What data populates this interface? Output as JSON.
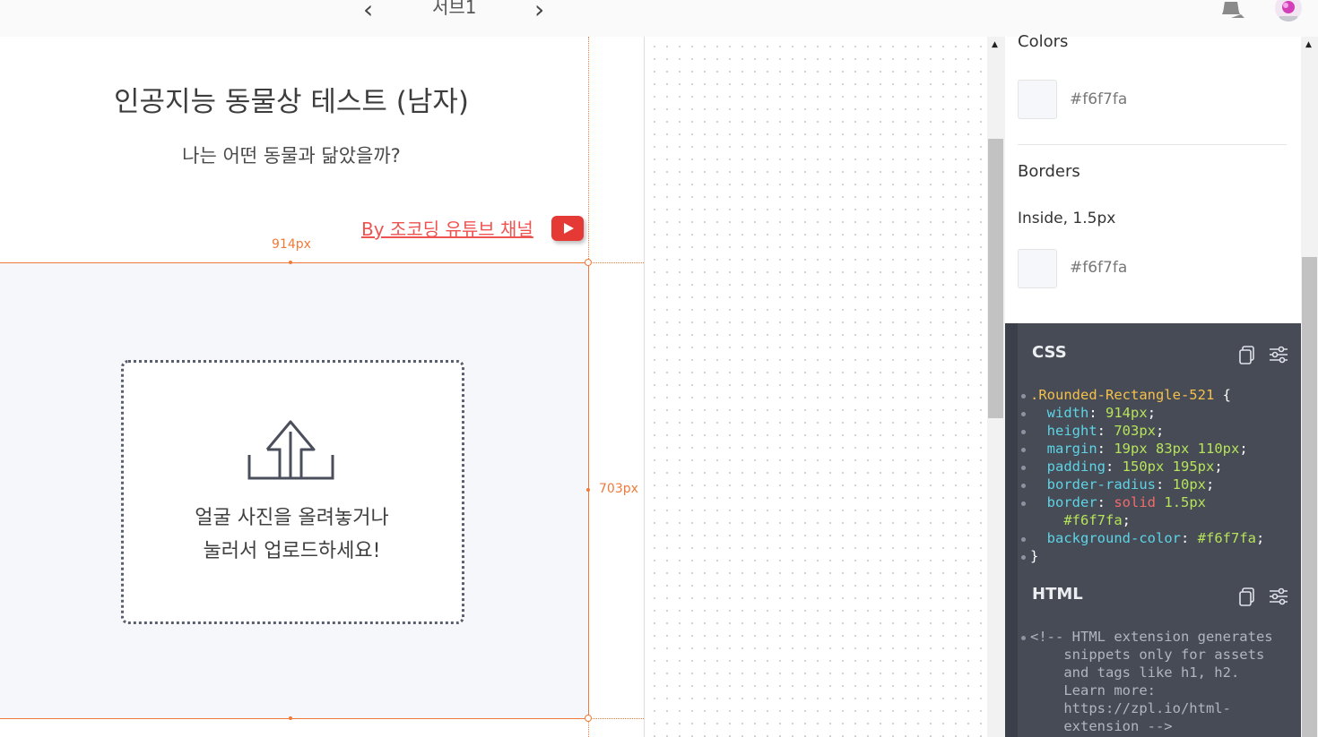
{
  "topbar": {
    "prev_icon": "chevron-left-icon",
    "next_icon": "chevron-right-icon",
    "screen_name": "서브1",
    "bell_icon": "bell-icon",
    "avatar_icon": "avatar"
  },
  "artboard": {
    "title": "인공지능 동물상 테스트 (남자)",
    "subtitle": "나는 어떤 동물과 닮았을까?",
    "youtube_link": "By 조코딩 유튜브 채널",
    "youtube_icon": "youtube-icon",
    "upload_icon": "upload-icon",
    "upload_text_line1": "얼굴 사진을 올려놓거나",
    "upload_text_line2": "눌러서 업로드하세요!",
    "width_label": "914px",
    "height_label": "703px",
    "guide_color": "#f07a3a",
    "rect_fill": "#f6f7fa"
  },
  "inspector": {
    "colors_label": "Colors",
    "color_hex": "#f6f7fa",
    "borders_label": "Borders",
    "border_desc": "Inside, 1.5px",
    "border_hex": "#f6f7fa",
    "css": {
      "heading": "CSS",
      "selector": ".Rounded-Rectangle-521",
      "width_prop": "width",
      "width_val": "914px",
      "height_prop": "height",
      "height_val": "703px",
      "margin_prop": "margin",
      "margin_val": "19px 83px 110px",
      "padding_prop": "padding",
      "padding_val": "150px 195px",
      "radius_prop": "border-radius",
      "radius_val": "10px",
      "border_prop": "border",
      "border_style": "solid",
      "border_width": "1.5px",
      "border_color": "#f6f7fa",
      "bg_prop": "background-color",
      "bg_val": "#f6f7fa"
    },
    "html": {
      "heading": "HTML",
      "comment_lines": [
        "<!-- HTML extension generates",
        "    snippets only for assets",
        "    and tags like h1, h2.",
        "    Learn more:",
        "    https://zpl.io/html-",
        "    extension -->"
      ]
    }
  }
}
